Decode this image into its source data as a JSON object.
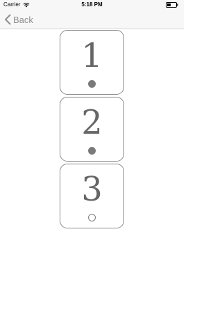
{
  "status_bar": {
    "carrier": "Carrier",
    "wifi_icon": "wifi-icon",
    "time": "5:18 PM",
    "battery_icon": "battery-icon"
  },
  "nav": {
    "back_label": "Back",
    "back_icon": "chevron-left-icon"
  },
  "cards": [
    {
      "number": "1",
      "dot": "filled"
    },
    {
      "number": "2",
      "dot": "filled"
    },
    {
      "number": "3",
      "dot": "empty"
    }
  ],
  "colors": {
    "bar_background": "#f7f7f7",
    "back_tint": "#8e8e93",
    "card_border": "#8a8a8a",
    "number_text": "#666666",
    "dot": "#7a7a7a"
  }
}
